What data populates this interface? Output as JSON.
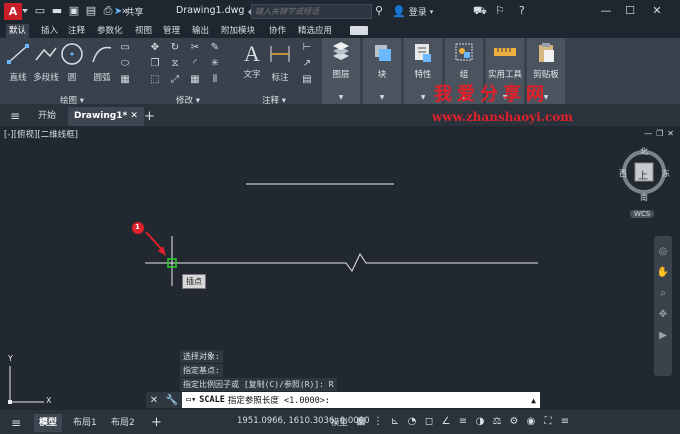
{
  "title": {
    "app_logo": "A",
    "share_label": "共享",
    "doc_title": "Drawing1.dwg",
    "search_placeholder": "键入关键字或短语",
    "login_label": "登录",
    "help_icon": "?",
    "colors": {
      "logo": "#c81e28",
      "titlebar": "#1e2730"
    }
  },
  "ribbon_tabs": [
    "默认",
    "插入",
    "注释",
    "参数化",
    "视图",
    "管理",
    "输出",
    "附加模块",
    "协作",
    "精选应用"
  ],
  "ribbon": {
    "draw_tools": [
      "直线",
      "多段线",
      "圆",
      "圆弧"
    ],
    "draw_panel": "绘图",
    "modify_panel": "修改",
    "annotation_tools": [
      "文字",
      "标注"
    ],
    "annotation_panel": "注释",
    "layers_label": "图层",
    "block_label": "块",
    "properties_label": "特性",
    "group_label": "组",
    "utilities_label": "实用工具",
    "clipboard_label": "剪贴板"
  },
  "file_tabs": {
    "start": "开始",
    "drawing": "Drawing1*",
    "add": "+"
  },
  "canvas": {
    "viewport_label": "[-][俯视][二维线框]",
    "viewcube": {
      "top": "上",
      "north": "北",
      "south": "南",
      "east": "东",
      "west": "西",
      "wcs": "WCS"
    },
    "tooltip": "插点",
    "marker_number": "1",
    "history": [
      "选择对象:",
      "指定基点:",
      "指定比例因子或 [复制(C)/参照(R)]: R"
    ],
    "watermark_cn": "我爱分享网",
    "watermark_url": "www.zhanshaoyi.com",
    "ucs_y": "Y",
    "ucs_x": "X"
  },
  "command": {
    "name": "SCALE",
    "prompt": "指定参照长度 <1.0000>:"
  },
  "status": {
    "tabs": [
      "模型",
      "布局1",
      "布局2"
    ],
    "coords": "1951.0966, 1610.3036, 0.0000",
    "model_btn": "模型"
  }
}
